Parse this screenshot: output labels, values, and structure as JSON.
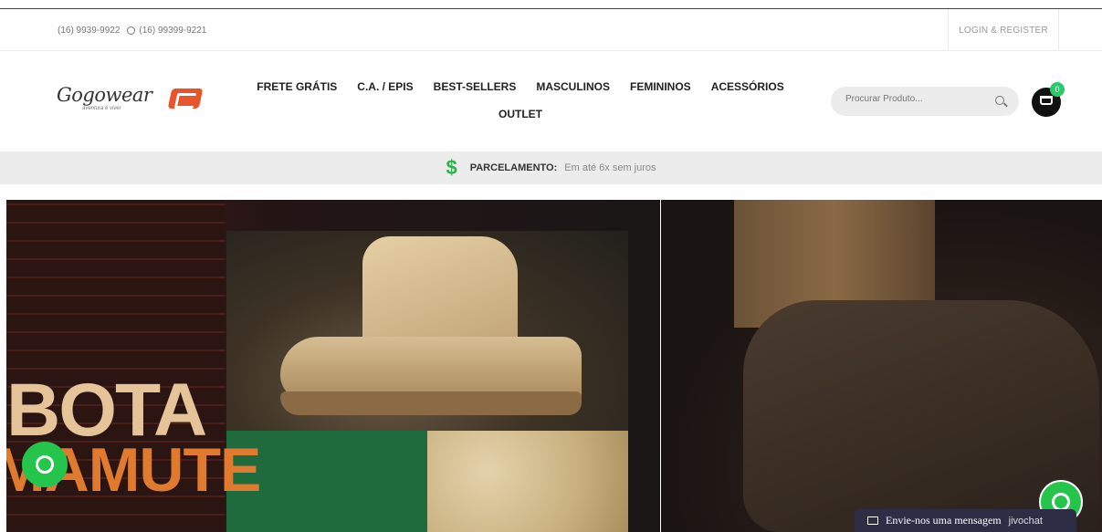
{
  "topbar": {
    "phone1": "(16) 9939-9922",
    "phone2": "(16) 99399-9221",
    "login": "LOGIN & REGISTER"
  },
  "brand": {
    "name": "Gogowear",
    "tagline": "aventura é viver"
  },
  "nav": {
    "items": [
      "FRETE GRÁTIS",
      "C.A. / EPIS",
      "BEST-SELLERS",
      "MASCULINOS",
      "FEMININOS",
      "ACESSÓRIOS"
    ],
    "second_row": "OUTLET"
  },
  "search": {
    "placeholder": "Procurar Produto..."
  },
  "cart": {
    "count": "0"
  },
  "promo": {
    "label": "PARCELAMENTO:",
    "text": "Em até 6x sem juros"
  },
  "hero": {
    "line1": "BOTA",
    "line2": "MAMUTE"
  },
  "chat": {
    "message": "Envie-nos uma mensagem",
    "brand": "jivochat"
  },
  "colors": {
    "accent_orange": "#e07a2e",
    "whatsapp_green": "#25c54b",
    "chat_bar": "#2d2d46"
  }
}
